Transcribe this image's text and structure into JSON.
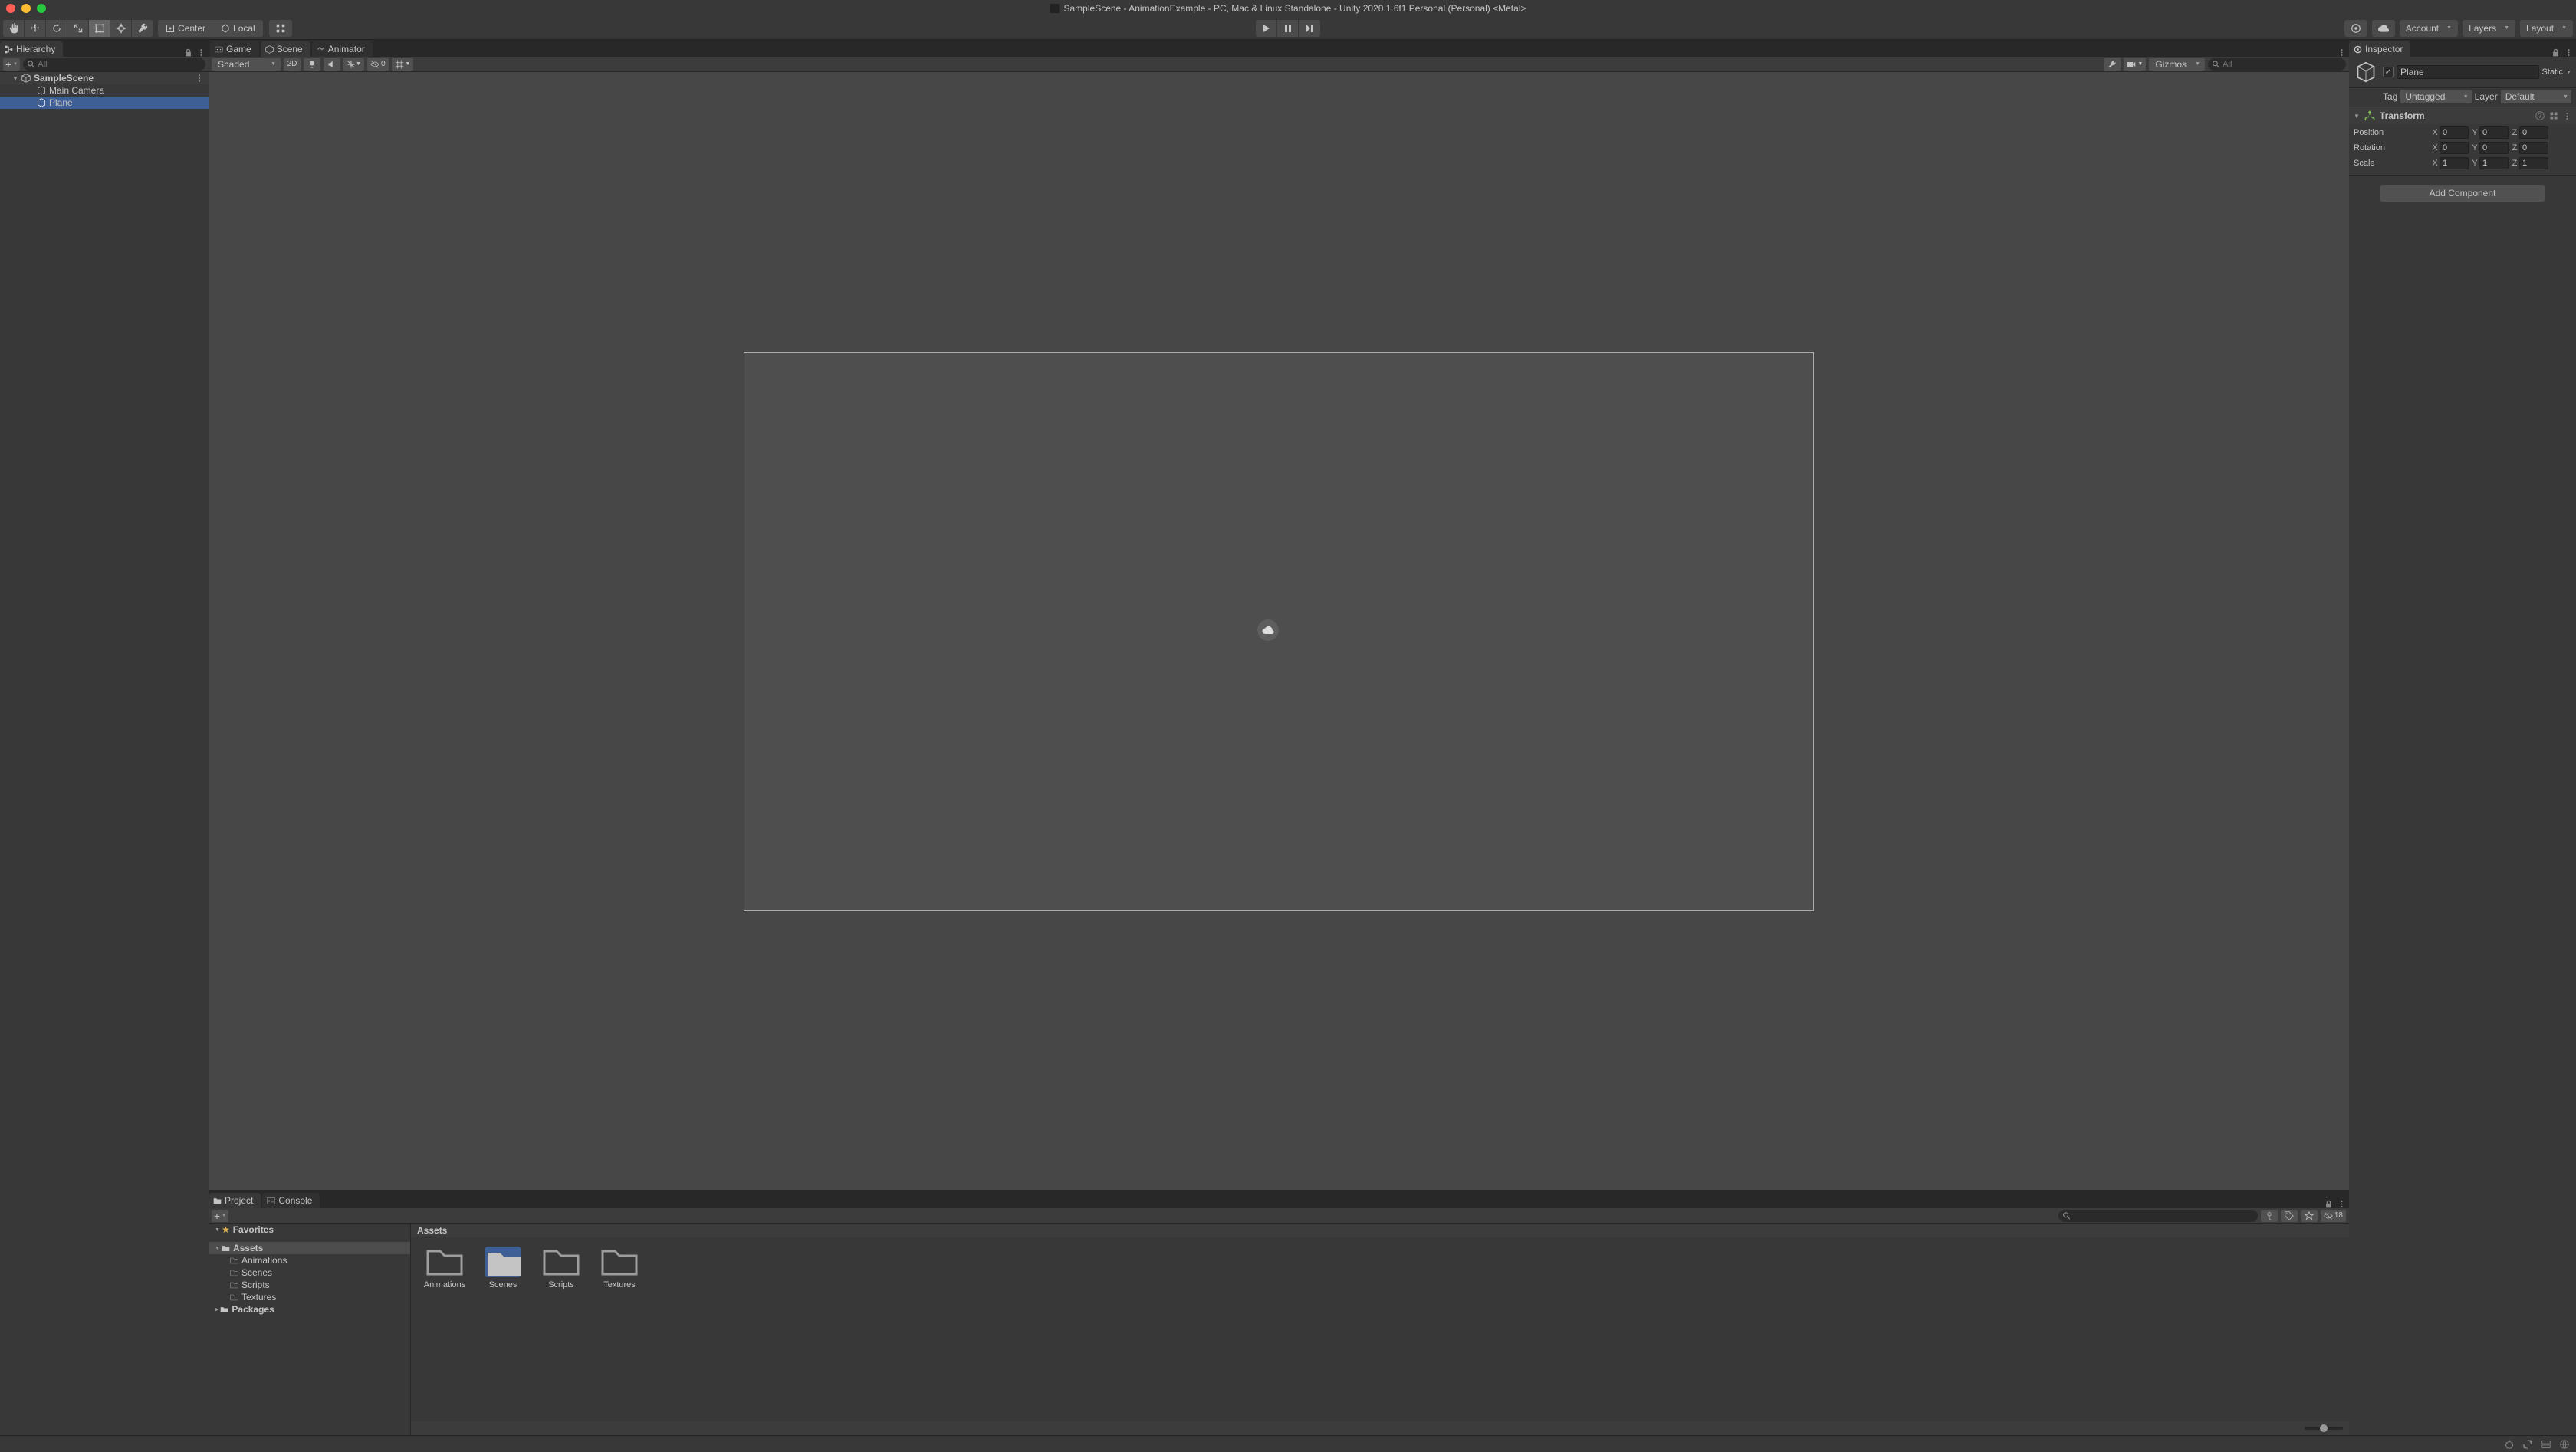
{
  "window": {
    "title": "SampleScene - AnimationExample - PC, Mac & Linux Standalone - Unity 2020.1.6f1 Personal (Personal) <Metal>"
  },
  "toolbar": {
    "pivot_center": "Center",
    "pivot_local": "Local",
    "account": "Account",
    "layers": "Layers",
    "layout": "Layout"
  },
  "hierarchy": {
    "tab": "Hierarchy",
    "search_placeholder": "All",
    "scene": "SampleScene",
    "items": [
      {
        "name": "Main Camera",
        "selected": false
      },
      {
        "name": "Plane",
        "selected": true
      }
    ]
  },
  "center_tabs": {
    "game": "Game",
    "scene": "Scene",
    "animator": "Animator"
  },
  "scene_toolbar": {
    "shaded": "Shaded",
    "twod": "2D",
    "gizmos": "Gizmos",
    "zero": "0",
    "search_placeholder": "All"
  },
  "inspector": {
    "tab": "Inspector",
    "name": "Plane",
    "static": "Static",
    "tag_label": "Tag",
    "tag_value": "Untagged",
    "layer_label": "Layer",
    "layer_value": "Default",
    "transform": {
      "title": "Transform",
      "position": {
        "label": "Position",
        "x": "0",
        "y": "0",
        "z": "0"
      },
      "rotation": {
        "label": "Rotation",
        "x": "0",
        "y": "0",
        "z": "0"
      },
      "scale": {
        "label": "Scale",
        "x": "1",
        "y": "1",
        "z": "1"
      }
    },
    "add_component": "Add Component"
  },
  "project": {
    "tab_project": "Project",
    "tab_console": "Console",
    "favorites": "Favorites",
    "assets": "Assets",
    "packages": "Packages",
    "folders": [
      "Animations",
      "Scenes",
      "Scripts",
      "Textures"
    ],
    "breadcrumb": "Assets",
    "grid": [
      {
        "name": "Animations",
        "selected": false
      },
      {
        "name": "Scenes",
        "selected": true
      },
      {
        "name": "Scripts",
        "selected": false
      },
      {
        "name": "Textures",
        "selected": false
      }
    ],
    "hidden_count": "18"
  }
}
